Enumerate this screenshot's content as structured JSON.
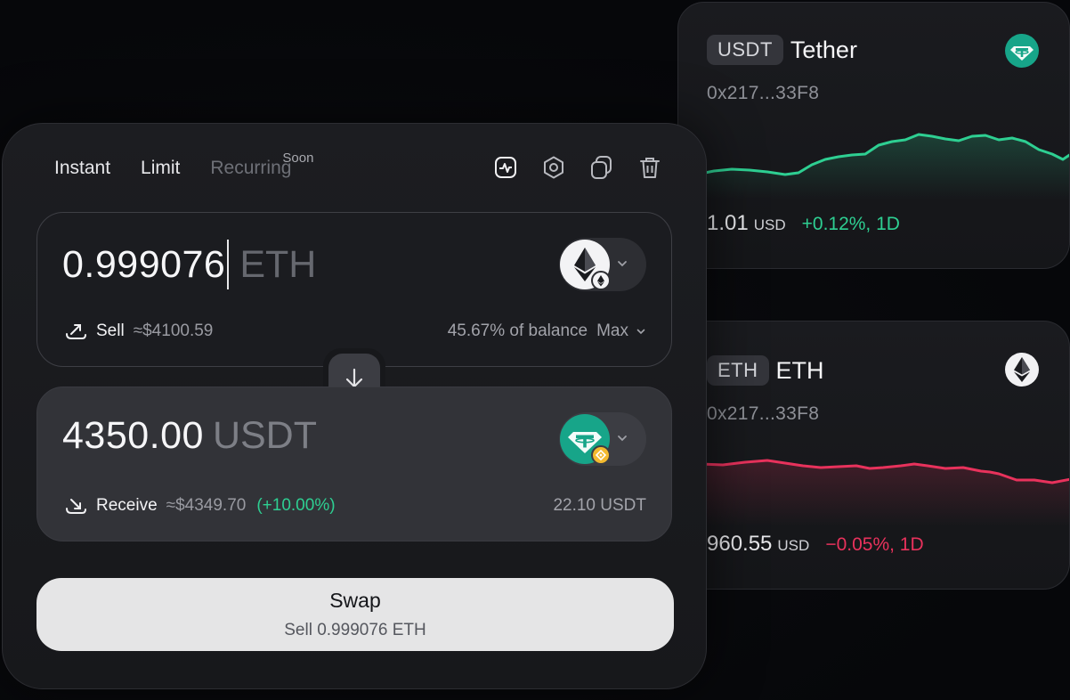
{
  "colors": {
    "accent_green": "#2ecf92",
    "accent_red": "#e8325c",
    "usdt_teal": "#17a589",
    "background": "#07080a"
  },
  "tabs": [
    {
      "label": "Instant"
    },
    {
      "label": "Limit"
    },
    {
      "label": "Recurring",
      "badge": "Soon",
      "disabled": true
    }
  ],
  "toolbar": {
    "icons": [
      "chart-icon",
      "settings-icon",
      "copy-icon",
      "trash-icon"
    ]
  },
  "sell": {
    "amount": "0.999076",
    "symbol": "ETH",
    "label": "Sell",
    "usd_value": "≈$4100.59",
    "balance_text": "45.67% of balance",
    "max_label": "Max",
    "token_icon": "eth-icon",
    "network_badge_icon": "ethereum-network-icon"
  },
  "receive": {
    "amount": "4350.00",
    "symbol": "USDT",
    "label": "Receive",
    "usd_value": "≈$4349.70",
    "change": "(+10.00%)",
    "right_value": "22.10 USDT",
    "token_icon": "tether-icon",
    "network_badge_icon": "bnb-chain-icon"
  },
  "swap_button": {
    "label": "Swap",
    "sublabel": "Sell 0.999076 ETH"
  },
  "token_cards": [
    {
      "ticker": "USDT",
      "name": "Tether",
      "address": "0x217...33F8",
      "price": "1.01",
      "unit": "USD",
      "change": "+0.12%, 1D",
      "direction": "up",
      "logo_icon": "tether-icon"
    },
    {
      "ticker": "ETH",
      "name": "ETH",
      "address": "0x217...33F8",
      "price": "960.55",
      "unit": "USD",
      "change": "−0.05%, 1D",
      "direction": "down",
      "logo_icon": "eth-icon"
    }
  ]
}
